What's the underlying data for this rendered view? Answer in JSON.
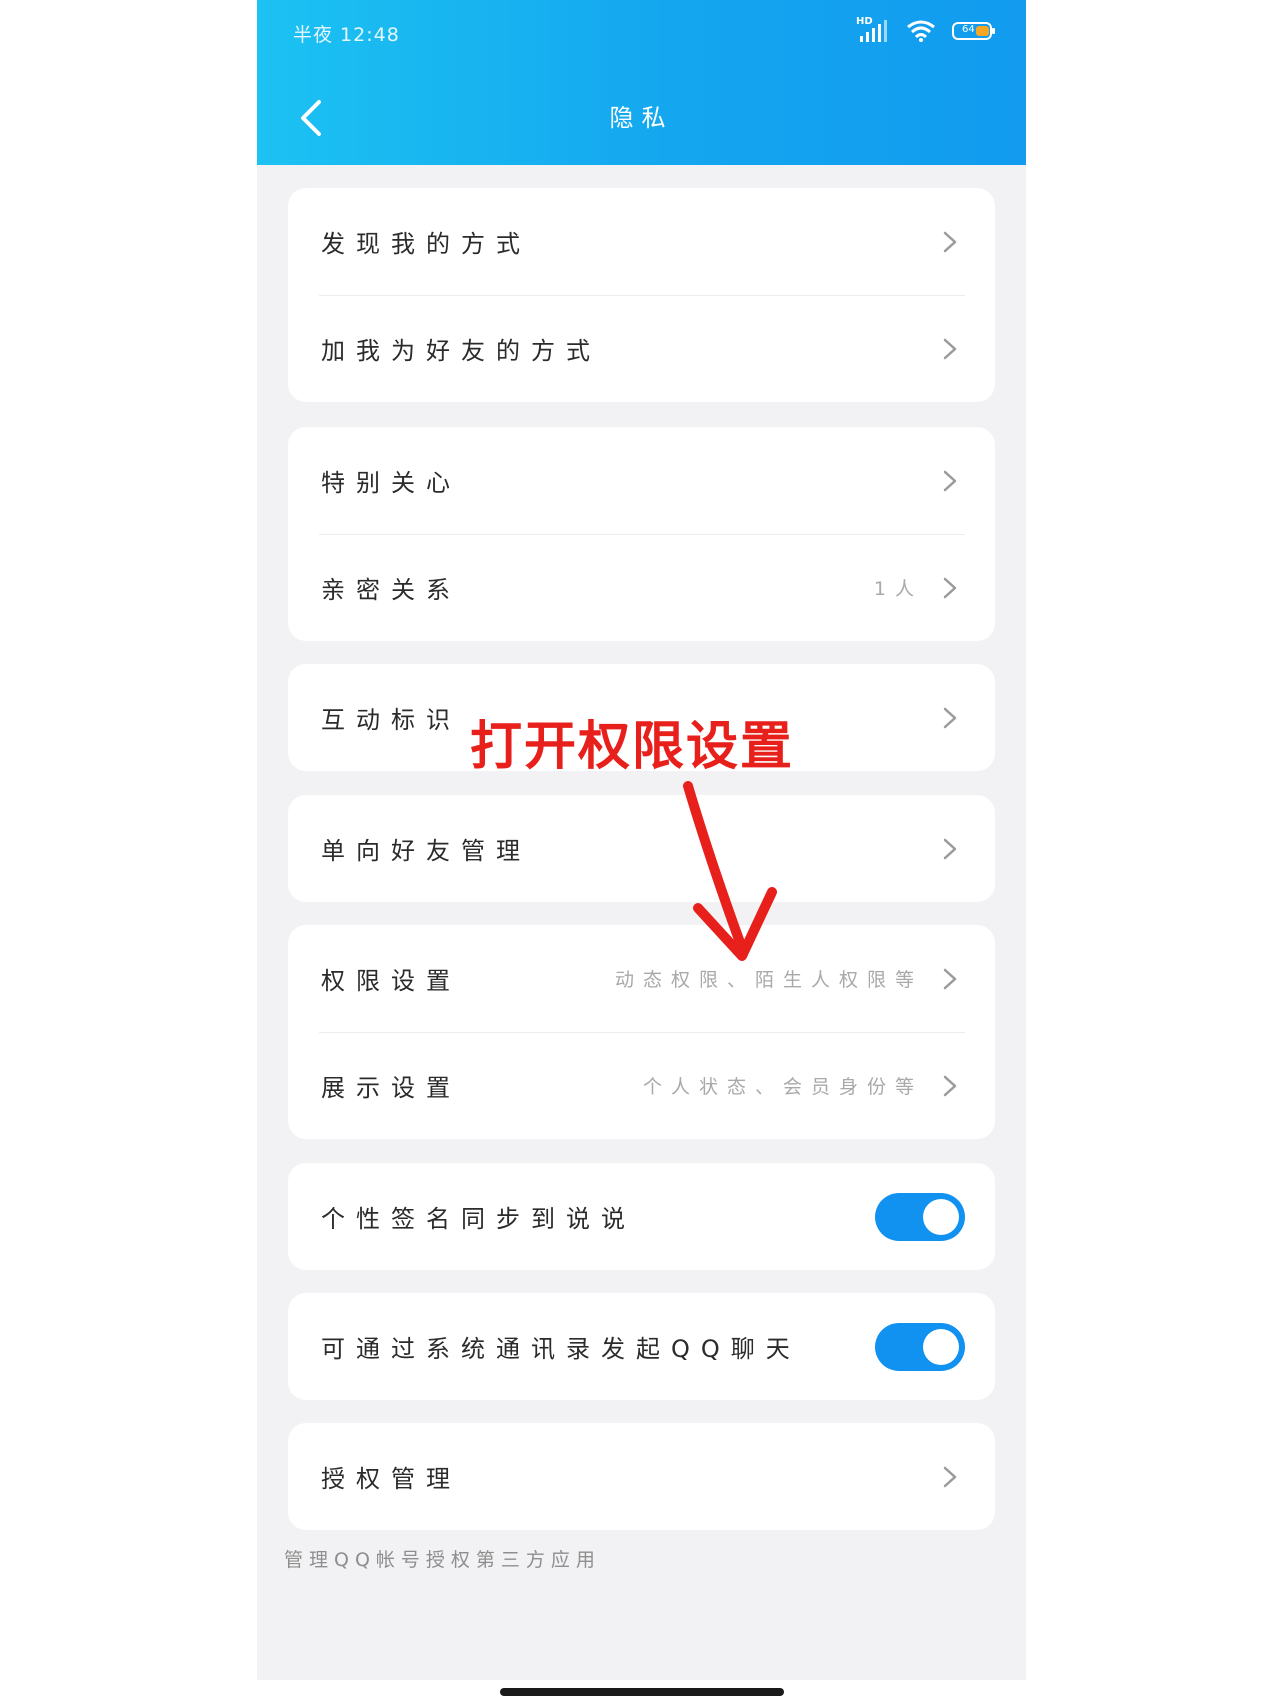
{
  "status_bar": {
    "time": "半夜 12:48",
    "network": "HD",
    "battery": "64"
  },
  "header": {
    "title": "隐私"
  },
  "groups": [
    {
      "rows": [
        {
          "label": "发现我的方式",
          "detail": ""
        },
        {
          "label": "加我为好友的方式",
          "detail": ""
        }
      ]
    },
    {
      "rows": [
        {
          "label": "特别关心",
          "detail": ""
        },
        {
          "label": "亲密关系",
          "detail": "1人"
        }
      ]
    },
    {
      "rows": [
        {
          "label": "互动标识",
          "detail": ""
        }
      ]
    },
    {
      "rows": [
        {
          "label": "单向好友管理",
          "detail": ""
        }
      ]
    },
    {
      "rows": [
        {
          "label": "权限设置",
          "detail": "动态权限、陌生人权限等"
        },
        {
          "label": "展示设置",
          "detail": "个人状态、会员身份等"
        }
      ]
    },
    {
      "rows": [
        {
          "label": "个性签名同步到说说",
          "toggle": true
        }
      ]
    },
    {
      "rows": [
        {
          "label": "可通过系统通讯录发起QQ聊天",
          "toggle": true
        }
      ]
    },
    {
      "rows": [
        {
          "label": "授权管理",
          "detail": ""
        }
      ]
    }
  ],
  "footnote": "管理QQ帐号授权第三方应用",
  "annotation": {
    "text": "打开权限设置",
    "color": "#e8201c"
  },
  "colors": {
    "header_start": "#1cc2f2",
    "header_end": "#129bef",
    "toggle_on": "#1292f0"
  }
}
